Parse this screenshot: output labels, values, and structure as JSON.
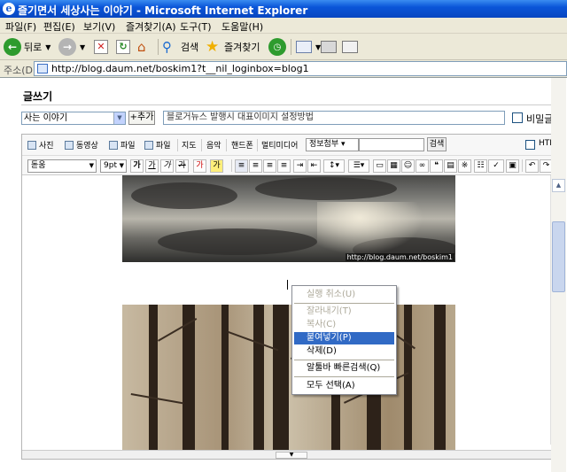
{
  "window": {
    "title": "즐기면서 세상사는 이야기 - Microsoft Internet Explorer"
  },
  "menu": [
    "파일(F)",
    "편집(E)",
    "보기(V)",
    "즐겨찾기(A)",
    "도구(T)",
    "도움말(H)"
  ],
  "toolbar": {
    "back": "뒤로",
    "search": "검색",
    "favorites": "즐겨찾기"
  },
  "address": {
    "label": "주소(D)",
    "url": "http://blog.daum.net/boskim1?t__nil_loginbox=blog1"
  },
  "page": {
    "heading": "글쓰기",
    "category": "사는 이야기",
    "add_button": "+추가",
    "title_value": "블로거뉴스 발행시 대표이미지 설정방법",
    "secret_label": "비밀글"
  },
  "editor": {
    "toolbar1": [
      "사진",
      "동영상",
      "파일",
      "파일",
      "지도",
      "음악",
      "핸드폰",
      "멀티미디어"
    ],
    "toolbar1_first_labels": {
      "photo": "사진",
      "video": "동영상",
      "file1": "파일",
      "file2": "파일",
      "map": "지도",
      "music": "음악",
      "phone": "핸드폰",
      "multimedia": "멀티미디어"
    },
    "info_select": "정보첨부 ▾",
    "search_button": "검색",
    "html_label": "HTML",
    "font_select": "돋움",
    "size_select": "9pt",
    "format_buttons": [
      "가",
      "가",
      "가",
      "가",
      "가",
      "가"
    ],
    "image_watermark": "http://blog.daum.net/boskim1"
  },
  "context_menu": {
    "undo": "실행 취소(U)",
    "cut": "잘라내기(T)",
    "copy": "복사(C)",
    "paste": "붙여넣기(P)",
    "delete": "삭제(D)",
    "quick_search": "알툴바 빠른검색(Q)",
    "select_all": "모두 선택(A)"
  },
  "colors": {
    "title_bar": "#0a55d8",
    "highlight": "#316ac5",
    "menu_disabled": "#aca899"
  }
}
